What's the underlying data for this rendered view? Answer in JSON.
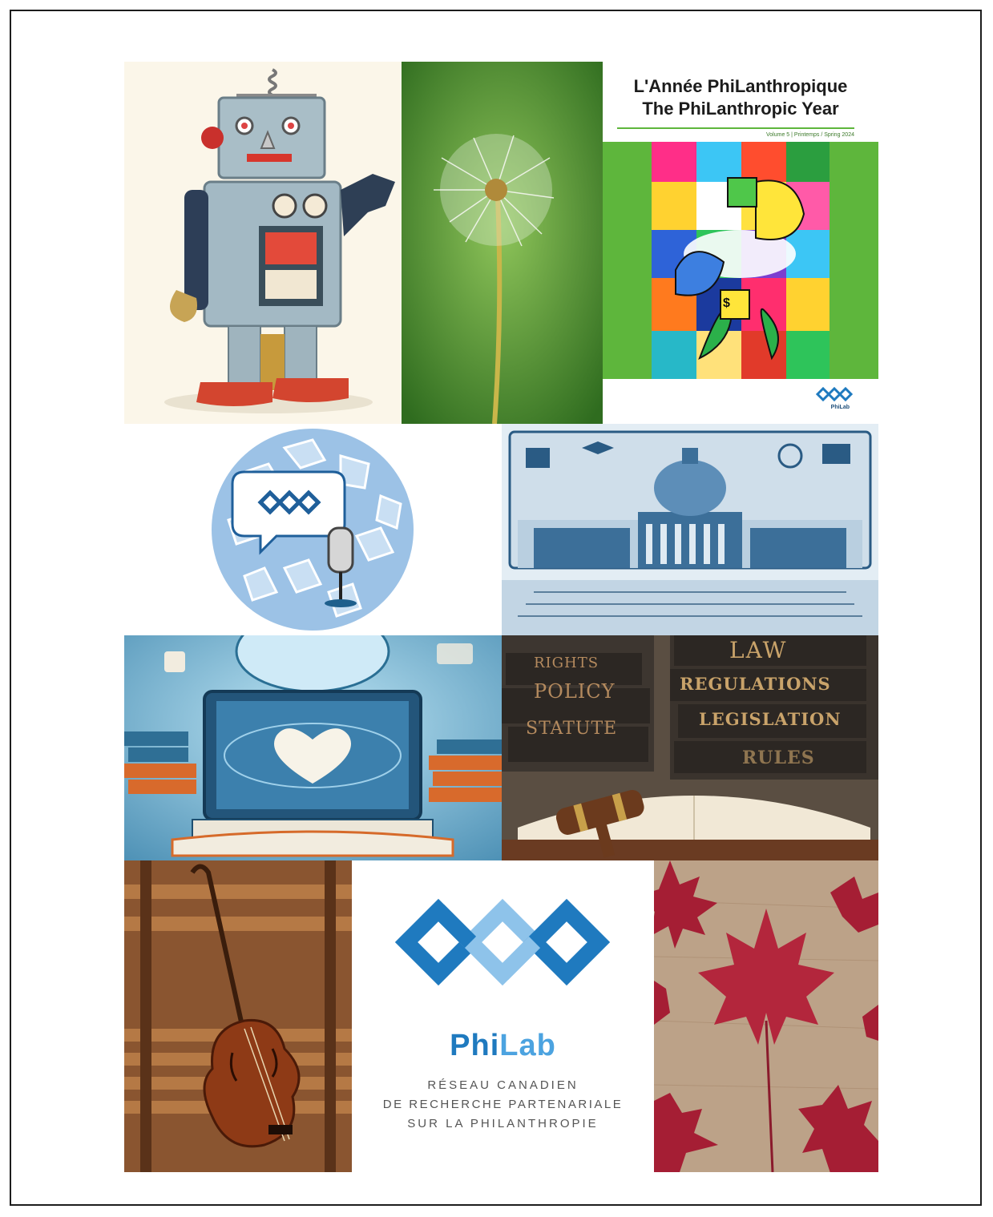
{
  "cover": {
    "title_fr": "L'Année PhiLanthropique",
    "title_en": "The PhiLanthropic Year",
    "volume": "Volume 5 | Printemps / Spring 2024",
    "logo_caption": "PhiLab",
    "colors": {
      "green": "#5eb63c",
      "dollar": "$"
    }
  },
  "books": {
    "spines": [
      "RIGHTS",
      "POLICY",
      "STATUTE",
      "LAW",
      "REGULATIONS",
      "LEGISLATION",
      "RULES"
    ]
  },
  "philab": {
    "name_part1": "Phi",
    "name_part2": "Lab",
    "line1": "RÉSEAU CANADIEN",
    "line2": "DE RECHERCHE PARTENARIALE",
    "line3": "SUR LA PHILANTHROPIE",
    "colors": {
      "dark_blue": "#1f7abf",
      "light_blue": "#8ec3ea",
      "text_gray": "#555555"
    }
  }
}
